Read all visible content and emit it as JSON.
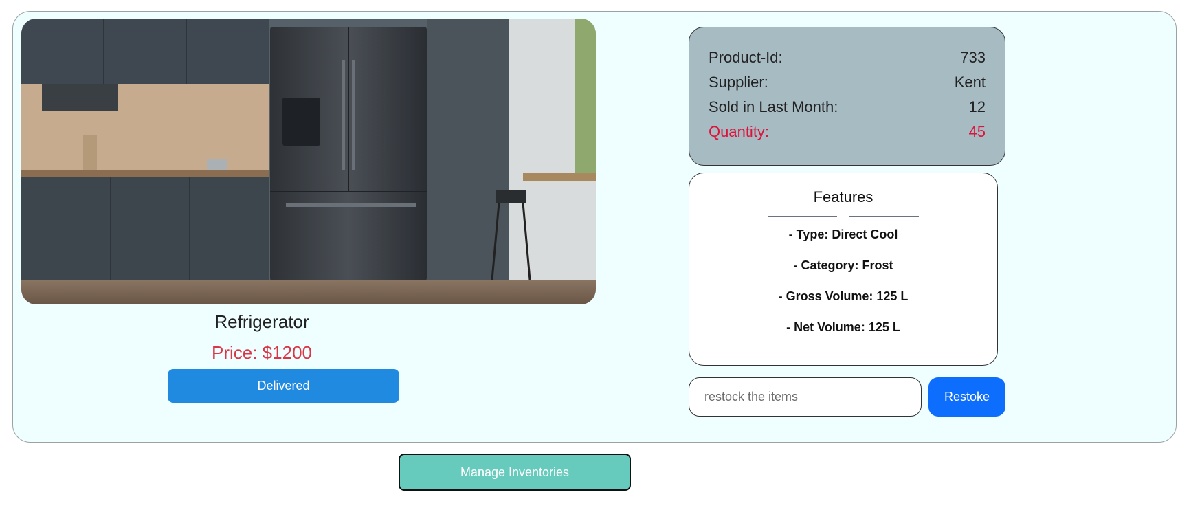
{
  "product": {
    "name": "Refrigerator",
    "price_label": "Price: $1200",
    "delivered_label": "Delivered",
    "image": "refrigerator-kitchen-photo"
  },
  "details": {
    "rows": [
      {
        "label": "Product-Id:",
        "value": "733"
      },
      {
        "label": "Supplier:",
        "value": "Kent"
      },
      {
        "label": "Sold in Last Month:",
        "value": "12"
      },
      {
        "label": "Quantity:",
        "value": "45"
      }
    ],
    "alert_color": "#dc143c"
  },
  "features": {
    "title": "Features",
    "items": [
      "- Type: Direct Cool",
      "- Category: Frost",
      "- Gross Volume: 125 L",
      "- Net Volume: 125 L"
    ]
  },
  "restock": {
    "placeholder": "restock the items",
    "button_label": "Restoke"
  },
  "manage": {
    "button_label": "Manage Inventories"
  },
  "colors": {
    "card_bg": "#effefe",
    "info_bg": "#a7bbc3",
    "delivered": "#1f8ae0",
    "restock": "#0d6efd",
    "manage": "#66cbbd",
    "price": "#dc3545"
  }
}
